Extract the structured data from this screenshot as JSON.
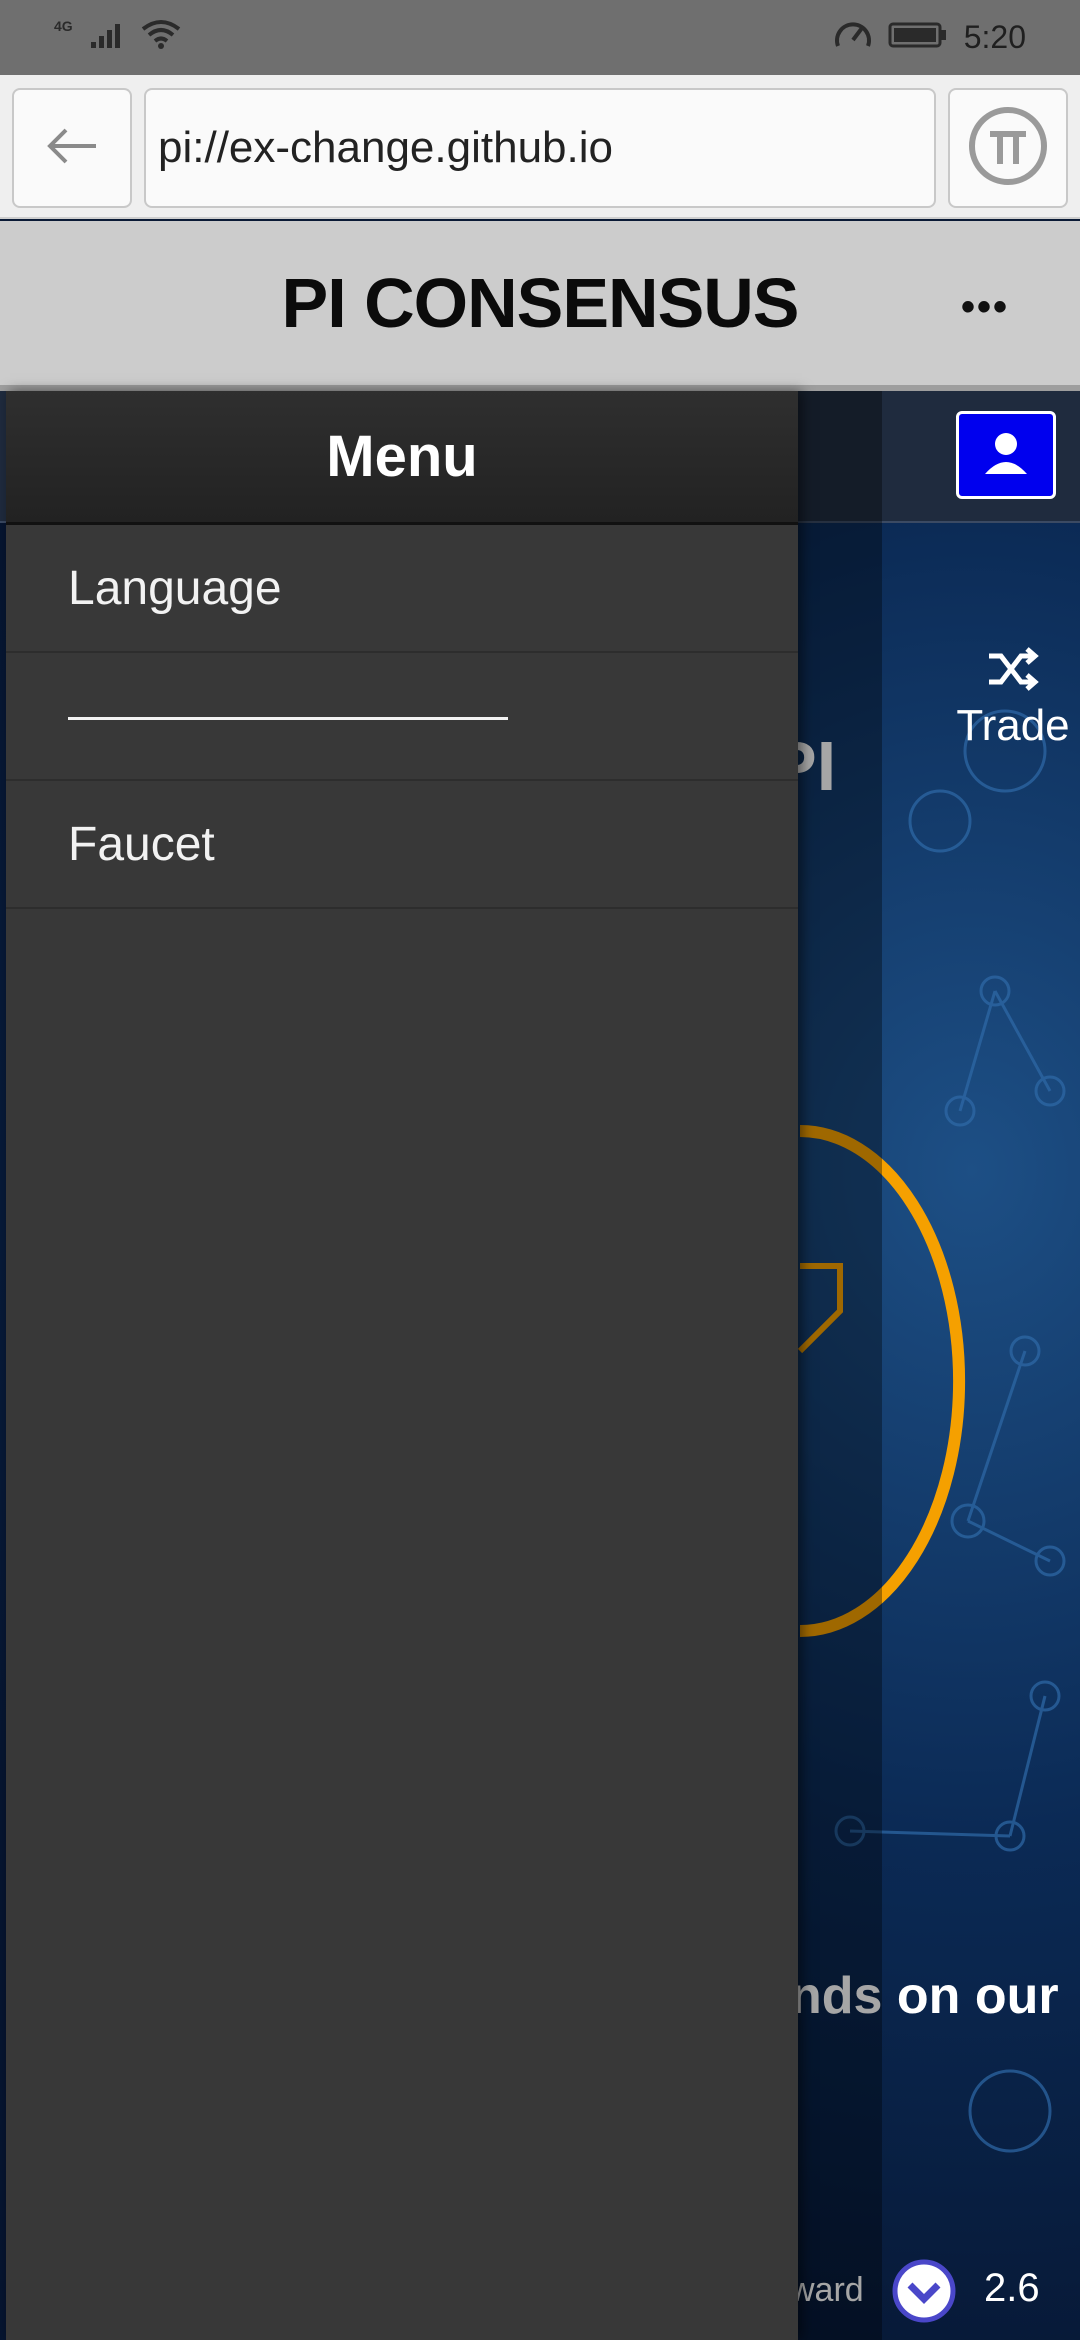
{
  "status_bar": {
    "network": "4G",
    "time": "5:20"
  },
  "browser": {
    "url": "pi://ex-change.github.io"
  },
  "header": {
    "title": "PI CONSENSUS",
    "more_label": "•••"
  },
  "page": {
    "hero_partial": "PI",
    "trade_label": "Trade",
    "banner_partial": "nds on our",
    "reward_label": "ward",
    "reward_value": "2.6"
  },
  "drawer": {
    "title": "Menu",
    "items": [
      {
        "label": "Language"
      },
      {
        "label": ""
      },
      {
        "label": "Faucet"
      }
    ]
  },
  "colors": {
    "profile_button": "#0000ee",
    "drawer_bg": "#383838",
    "accent_ring": "#f5a000"
  }
}
